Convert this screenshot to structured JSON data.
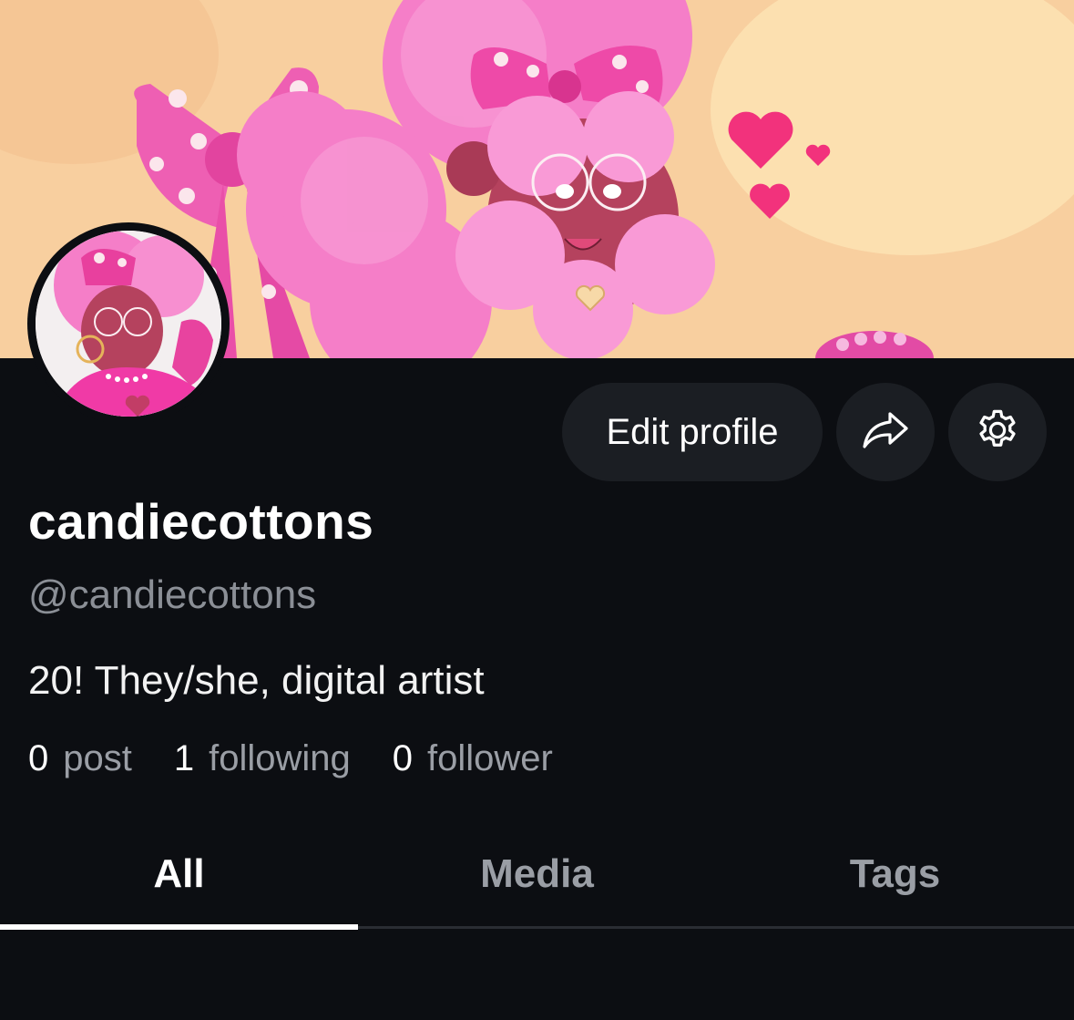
{
  "profile": {
    "display_name": "candiecottons",
    "handle": "@candiecottons",
    "bio": "20! They/she, digital artist"
  },
  "actions": {
    "edit_label": "Edit profile",
    "share_icon": "share-arrow-icon",
    "settings_icon": "gear-icon"
  },
  "stats": [
    {
      "count": "0",
      "label": "post"
    },
    {
      "count": "1",
      "label": "following"
    },
    {
      "count": "0",
      "label": "follower"
    }
  ],
  "tabs": [
    {
      "label": "All",
      "active": true
    },
    {
      "label": "Media",
      "active": false
    },
    {
      "label": "Tags",
      "active": false
    }
  ],
  "colors": {
    "background": "#0c0e12",
    "button_bg": "#1b1e23",
    "muted_text": "#8b8f96",
    "accent_pink": "#f35bb8"
  }
}
